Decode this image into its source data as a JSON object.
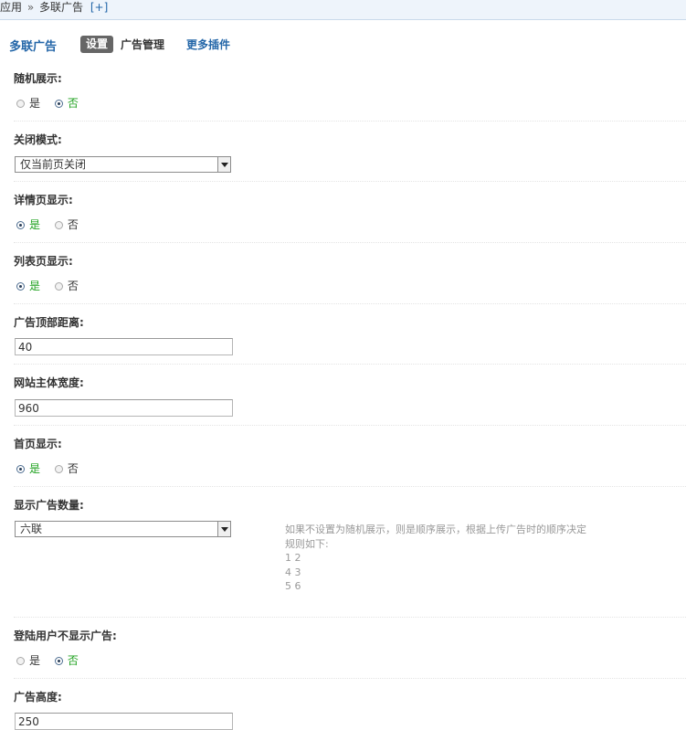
{
  "breadcrumb": {
    "app": "应用",
    "sep": "»",
    "current": "多联广告",
    "add": "[+]"
  },
  "tabs": {
    "title": "多联广告",
    "settings": "设置",
    "manage": "广告管理",
    "more": "更多插件"
  },
  "settings": {
    "random": {
      "label": "随机展示:",
      "yes": "是",
      "no": "否",
      "selected": "no"
    },
    "close_mode": {
      "label": "关闭模式:",
      "value": "仅当前页关闭"
    },
    "detail_page": {
      "label": "详情页显示:",
      "yes": "是",
      "no": "否",
      "selected": "yes"
    },
    "list_page": {
      "label": "列表页显示:",
      "yes": "是",
      "no": "否",
      "selected": "yes"
    },
    "ad_top": {
      "label": "广告顶部距离:",
      "value": "40"
    },
    "site_width": {
      "label": "网站主体宽度:",
      "value": "960"
    },
    "home_page": {
      "label": "首页显示:",
      "yes": "是",
      "no": "否",
      "selected": "yes"
    },
    "ad_count": {
      "label": "显示广告数量:",
      "value": "六联",
      "help": [
        "如果不设置为随机展示，则是顺序展示，根据上传广告时的顺序决定",
        "规则如下:",
        "1 2",
        "4 3",
        "5 6"
      ]
    },
    "hide_logged_in": {
      "label": "登陆用户不显示广告:",
      "yes": "是",
      "no": "否",
      "selected": "no"
    },
    "ad_height": {
      "label": "广告高度:",
      "value": "250"
    }
  },
  "colors": {
    "accent": "#2366a8",
    "selected": "#1ea11e",
    "breadcrumb_bg": "#eef4fb"
  }
}
